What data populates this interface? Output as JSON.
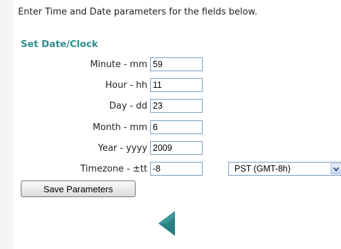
{
  "intro_text": "Enter Time and Date parameters for the fields below.",
  "section_title": "Set Date/Clock",
  "fields": [
    {
      "label": "Minute - mm",
      "value": "59"
    },
    {
      "label": "Hour - hh",
      "value": "11"
    },
    {
      "label": "Day - dd",
      "value": "23"
    },
    {
      "label": "Month - mm",
      "value": "6"
    },
    {
      "label": "Year - yyyy",
      "value": "2009"
    },
    {
      "label": "Timezone - ±tt",
      "value": "-8"
    }
  ],
  "timezone_select": {
    "selected": "PST (GMT-8h)"
  },
  "save_button": "Save Parameters",
  "icons": {
    "back": "back-arrow-icon",
    "dropdown": "chevron-down-icon"
  },
  "colors": {
    "section_title": "#2e8b8b",
    "back_arrow": "#2a7f86"
  }
}
